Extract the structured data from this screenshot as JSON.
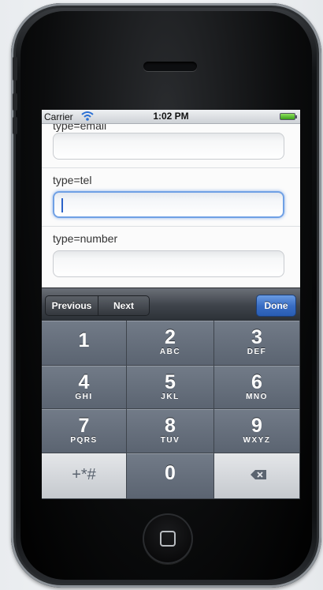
{
  "status_bar": {
    "carrier": "Carrier",
    "time": "1:02 PM"
  },
  "form": {
    "fields": [
      {
        "label": "type=email",
        "value": ""
      },
      {
        "label": "type=tel",
        "value": ""
      },
      {
        "label": "type=number",
        "value": ""
      }
    ]
  },
  "toolbar": {
    "previous_label": "Previous",
    "next_label": "Next",
    "done_label": "Done"
  },
  "keypad": {
    "keys": [
      {
        "digit": "1",
        "letters": ""
      },
      {
        "digit": "2",
        "letters": "ABC"
      },
      {
        "digit": "3",
        "letters": "DEF"
      },
      {
        "digit": "4",
        "letters": "GHI"
      },
      {
        "digit": "5",
        "letters": "JKL"
      },
      {
        "digit": "6",
        "letters": "MNO"
      },
      {
        "digit": "7",
        "letters": "PQRS"
      },
      {
        "digit": "8",
        "letters": "TUV"
      },
      {
        "digit": "9",
        "letters": "WXYZ"
      },
      {
        "digit": "+*#",
        "letters": ""
      },
      {
        "digit": "0",
        "letters": ""
      },
      {
        "digit": "",
        "letters": ""
      }
    ],
    "icons": {
      "backspace": "backspace-icon"
    }
  },
  "colors": {
    "focus_ring": "#6fa0e5",
    "done_button": "#3a6ec4",
    "keypad_key": "#65707d",
    "battery": "#5ecb2e"
  }
}
